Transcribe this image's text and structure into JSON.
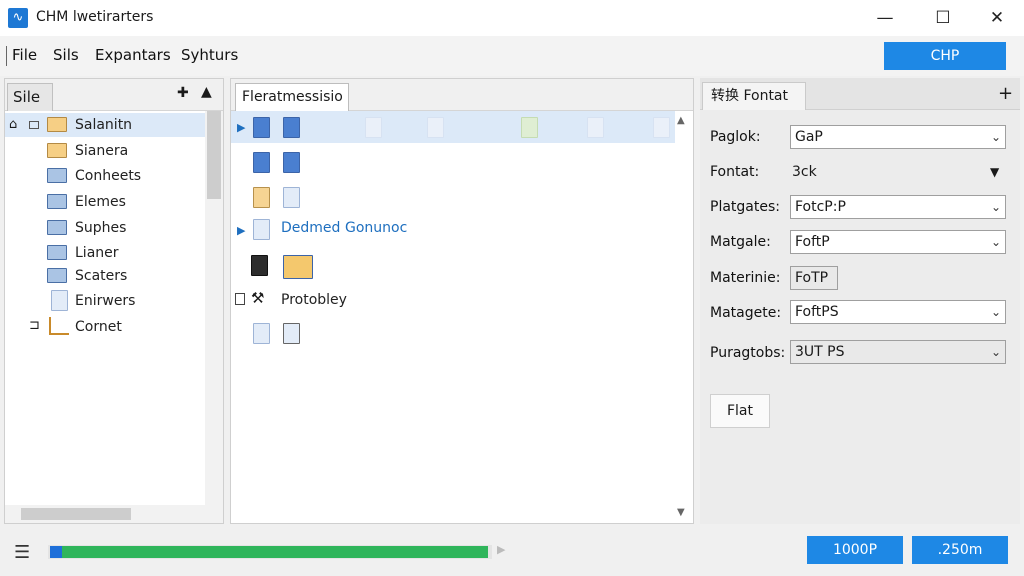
{
  "window": {
    "title": "CHM lwetirarters",
    "app_icon": "wave-icon",
    "controls": {
      "minimize": "—",
      "maximize": "☐",
      "close": "✕"
    }
  },
  "menu": {
    "items": [
      "File",
      "Sils",
      "Expantars",
      "Syhturs"
    ],
    "action_button": "CHP"
  },
  "left_panel": {
    "tab": "Sile",
    "pin_icon": "✚",
    "up_icon": "▲",
    "tree": [
      {
        "label": "Salanitn",
        "expander": "⌂",
        "selected": true
      },
      {
        "label": "Sianera"
      },
      {
        "label": "Conheets"
      },
      {
        "label": "Elemes"
      },
      {
        "label": "Suphes"
      },
      {
        "label": "Lianer"
      },
      {
        "label": "Scaters"
      },
      {
        "label": "Enirwers"
      },
      {
        "label": "Cornet",
        "expander": "⊐"
      }
    ]
  },
  "middle_panel": {
    "tab": "Fleratmessisio",
    "link_a": "Dedmed",
    "link_b": "Gonunoc",
    "tool_label": "Protobley"
  },
  "right_panel": {
    "tab": "转换 Fontat",
    "add": "+",
    "properties": [
      {
        "label": "Paglok:",
        "value": "GaP"
      },
      {
        "label": "Fontat:",
        "value": "3ck"
      },
      {
        "label": "Platgates:",
        "value": "FotcP:P"
      },
      {
        "label": "Matgale:",
        "value": "FoftP"
      },
      {
        "label": "Materinie:",
        "value": "FoTP"
      },
      {
        "label": "Matagete:",
        "value": "FoftPS"
      },
      {
        "label": "Puragtobs:",
        "value": "3UT PS"
      }
    ],
    "flat_button": "Flat"
  },
  "status": {
    "progress": 1.0,
    "button_left": "1000P",
    "button_right": ".250m",
    "colors": {
      "accent": "#1e88e5",
      "progress": "#2fb55b"
    }
  }
}
